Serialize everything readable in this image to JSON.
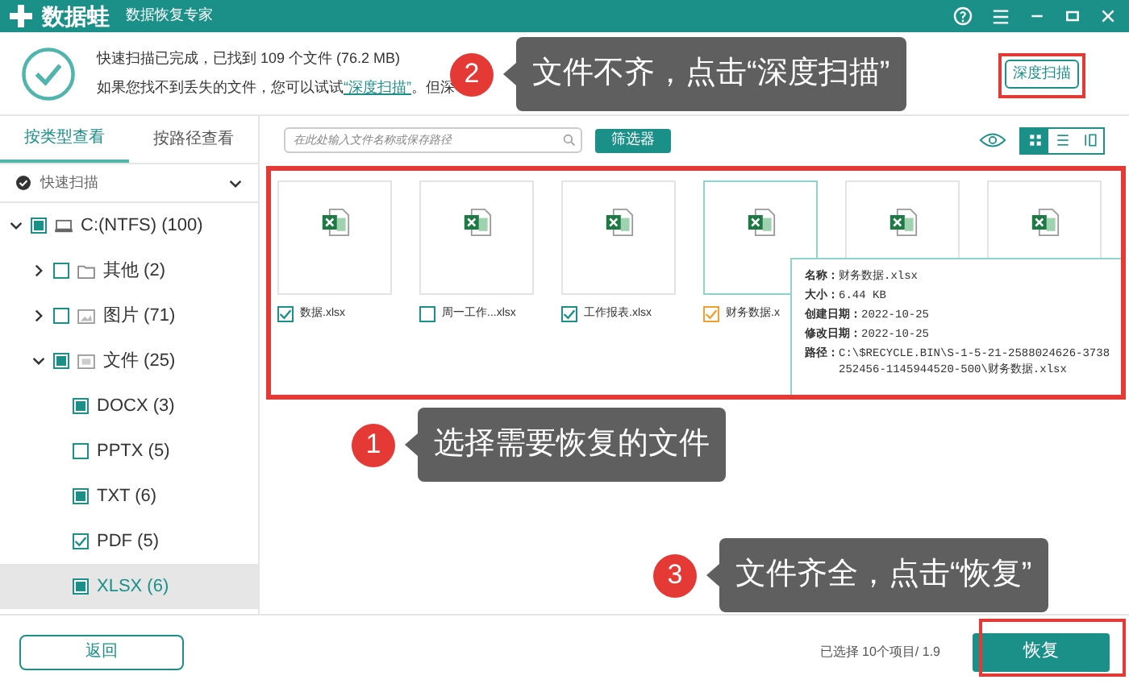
{
  "app": {
    "name": "数据蛙",
    "subtitle": "数据恢复专家"
  },
  "header": {
    "line1": "快速扫描已完成，已找到 109 个文件 (76.2 MB)",
    "line2_before": "如果您找不到丢失的文件，您可以试试",
    "line2_link": "“深度扫描”",
    "line2_after": "。但深",
    "deep_scan_button": "深度扫描"
  },
  "sidebar": {
    "tabs": [
      {
        "label": "按类型查看",
        "selected": true
      },
      {
        "label": "按路径查看",
        "selected": false
      }
    ],
    "scan_mode": "快速扫描",
    "tree": [
      {
        "label": "C:(NTFS) (100)",
        "kind": "drive",
        "checked": false,
        "mixed": true,
        "expanded": true,
        "selected": false,
        "children": [
          {
            "label": "其他 (2)",
            "kind": "folder",
            "checked": false,
            "mixed": false,
            "expanded": false,
            "selected": false
          },
          {
            "label": "图片 (71)",
            "kind": "image",
            "checked": false,
            "mixed": false,
            "expanded": false,
            "selected": false
          },
          {
            "label": "文件 (25)",
            "kind": "doc",
            "checked": false,
            "mixed": true,
            "expanded": true,
            "selected": false,
            "children": [
              {
                "label": "DOCX (3)",
                "checked": false,
                "mixed": true,
                "selected": false
              },
              {
                "label": "PPTX (5)",
                "checked": false,
                "mixed": false,
                "selected": false
              },
              {
                "label": "TXT (6)",
                "checked": false,
                "mixed": true,
                "selected": false
              },
              {
                "label": "PDF (5)",
                "checked": true,
                "selected": false
              },
              {
                "label": "XLSX (6)",
                "checked": false,
                "mixed": true,
                "selected": true
              }
            ]
          }
        ]
      }
    ]
  },
  "toolbar": {
    "search_placeholder": "在此处输入文件名称或保存路径",
    "filter_button": "筛选器",
    "views": [
      {
        "kind": "grid",
        "selected": true
      },
      {
        "kind": "list",
        "selected": false
      },
      {
        "kind": "columns",
        "selected": false
      }
    ]
  },
  "files": [
    {
      "label": "数据.xlsx",
      "checked": true,
      "hovered": false
    },
    {
      "label": "周一工作...xlsx",
      "checked": false,
      "hovered": false
    },
    {
      "label": "工作报表.xlsx",
      "checked": true,
      "hovered": false
    },
    {
      "label": "财务数据.x",
      "checked": true,
      "hovered": true
    },
    {
      "hovered": false
    },
    {
      "hovered": false
    }
  ],
  "tooltip": [
    {
      "label": "名称：",
      "value": "财务数据.xlsx"
    },
    {
      "label": "大小：",
      "value": "6.44 KB"
    },
    {
      "label": "创建日期：",
      "value": "2022-10-25"
    },
    {
      "label": "修改日期：",
      "value": "2022-10-25"
    },
    {
      "label": "路径：",
      "value": "C:\\$RECYCLE.BIN\\S-1-5-21-2588024626-3738252456-1145944520-500\\财务数据.xlsx"
    }
  ],
  "callouts": [
    {
      "number": "2",
      "text": "文件不齐，点击“深度扫描”"
    },
    {
      "number": "1",
      "text": "选择需要恢复的文件"
    },
    {
      "number": "3",
      "text": "文件齐全，点击“恢复”"
    }
  ],
  "footer": {
    "back_button": "返回",
    "status": "已选择 10个项目/ 1.9",
    "recover_button": "恢复"
  }
}
